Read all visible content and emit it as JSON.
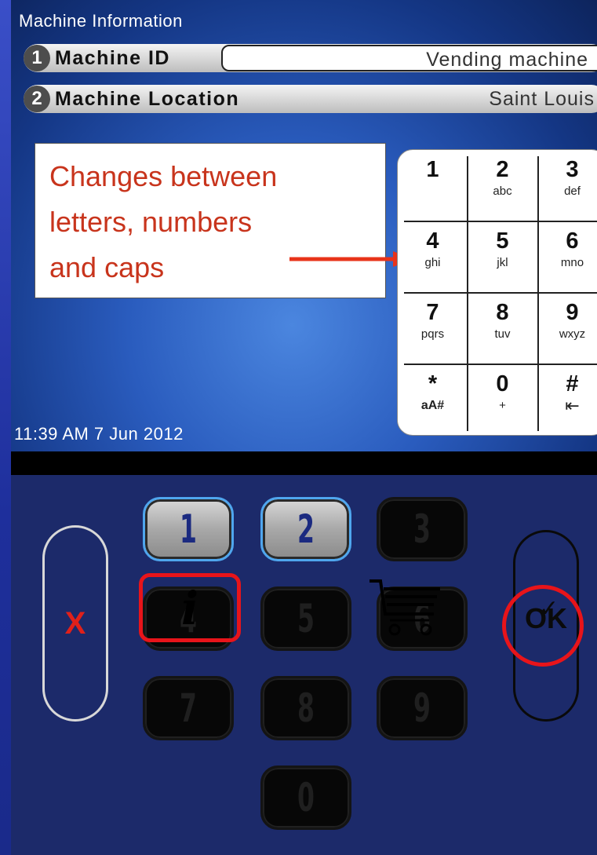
{
  "screen": {
    "title": "Machine Information",
    "fields": [
      {
        "number": "1",
        "label": "Machine ID",
        "value": "Vending machine"
      },
      {
        "number": "2",
        "label": "Machine Location",
        "value": "Saint Louis"
      }
    ],
    "datetime": "11:39 AM 7 Jun 2012"
  },
  "callout": {
    "lines": [
      "Changes between",
      "letters, numbers",
      "and caps"
    ]
  },
  "phone_keypad": {
    "keys": [
      {
        "num": "1",
        "sub": ""
      },
      {
        "num": "2",
        "sub": "abc"
      },
      {
        "num": "3",
        "sub": "def"
      },
      {
        "num": "4",
        "sub": "ghi"
      },
      {
        "num": "5",
        "sub": "jkl"
      },
      {
        "num": "6",
        "sub": "mno"
      },
      {
        "num": "7",
        "sub": "pqrs"
      },
      {
        "num": "8",
        "sub": "tuv"
      },
      {
        "num": "9",
        "sub": "wxyz"
      },
      {
        "num": "*",
        "sub": "aA#"
      },
      {
        "num": "0",
        "sub": "+"
      },
      {
        "num": "#",
        "sub": "⇤"
      }
    ]
  },
  "hardware_keypad": {
    "keys": [
      "1",
      "2",
      "3",
      "4",
      "5",
      "6",
      "7",
      "8",
      "9",
      "0"
    ],
    "active_keys": [
      "1",
      "2"
    ],
    "cancel_label": "X",
    "ok_label": "OK",
    "info_label": "i"
  },
  "colors": {
    "callout_text": "#c8341c",
    "highlight": "#e8141a",
    "cancel": "#e0201a",
    "active_key_border": "#4fa6ee"
  },
  "icons": [
    "cart-icon",
    "info-icon",
    "ok-check-icon",
    "arrow-icon"
  ]
}
